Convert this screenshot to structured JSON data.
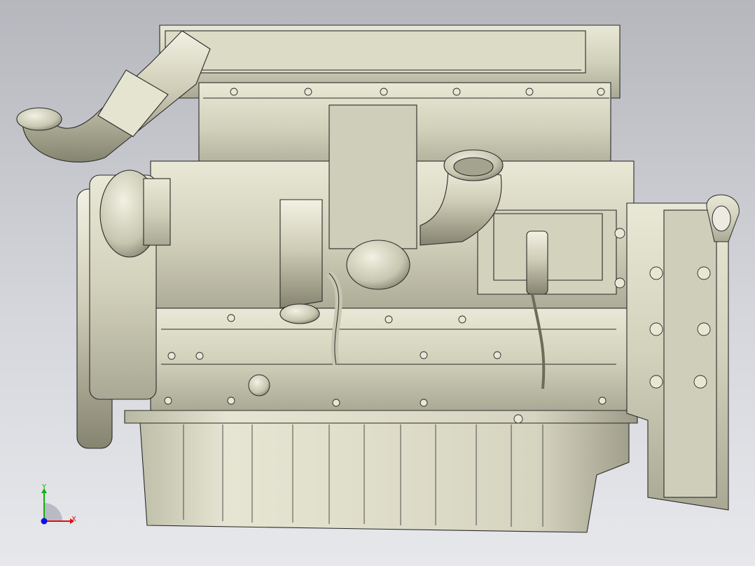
{
  "viewport": {
    "colors": {
      "bg_top": "#b5b7bd",
      "bg_bottom": "#e7e8ec",
      "metal": "#d8d7c2",
      "edge": "#2a2a2a"
    },
    "model_name_icon": "engine-3d-model"
  },
  "triad": {
    "x_label": "X",
    "y_label": "Y",
    "colors": {
      "x": "#e01010",
      "y": "#10b010",
      "z": "#1010e0"
    }
  }
}
